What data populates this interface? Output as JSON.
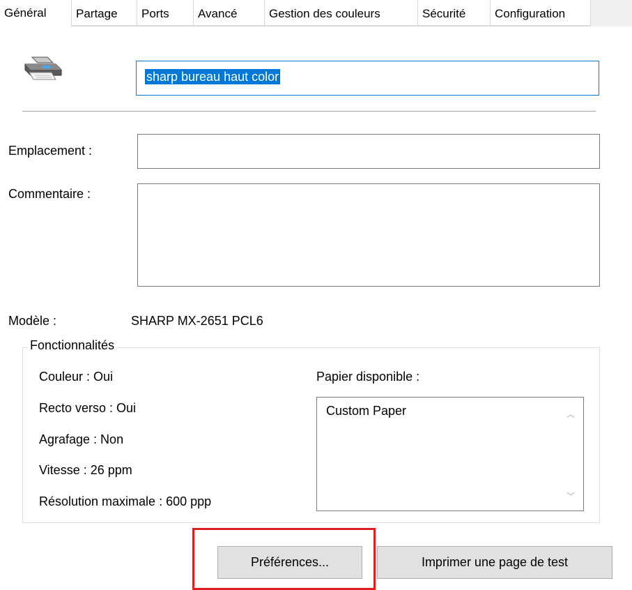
{
  "tabs": [
    {
      "label": "Général"
    },
    {
      "label": "Partage"
    },
    {
      "label": "Ports"
    },
    {
      "label": "Avancé"
    },
    {
      "label": "Gestion des couleurs"
    },
    {
      "label": "Sécurité"
    },
    {
      "label": "Configuration"
    }
  ],
  "active_tab": "Général",
  "printer": {
    "icon": "printer-icon",
    "name": "sharp bureau haut color"
  },
  "location": {
    "label": "Emplacement :",
    "value": ""
  },
  "comment": {
    "label": "Commentaire :",
    "value": ""
  },
  "model": {
    "label": "Modèle :",
    "value": "SHARP MX-2651 PCL6"
  },
  "features": {
    "title": "Fonctionnalités",
    "items": [
      "Couleur : Oui",
      "Recto verso : Oui",
      "Agrafage : Non",
      "Vitesse : 26 ppm",
      "Résolution maximale : 600 ppp"
    ],
    "paper_label": "Papier disponible :",
    "paper_items": [
      "Custom Paper"
    ]
  },
  "buttons": {
    "preferences": "Préférences...",
    "test_page": "Imprimer une page de test"
  },
  "colors": {
    "selection": "#0078d7",
    "highlight_box": "#e02020",
    "button_face": "#e1e1e1"
  }
}
